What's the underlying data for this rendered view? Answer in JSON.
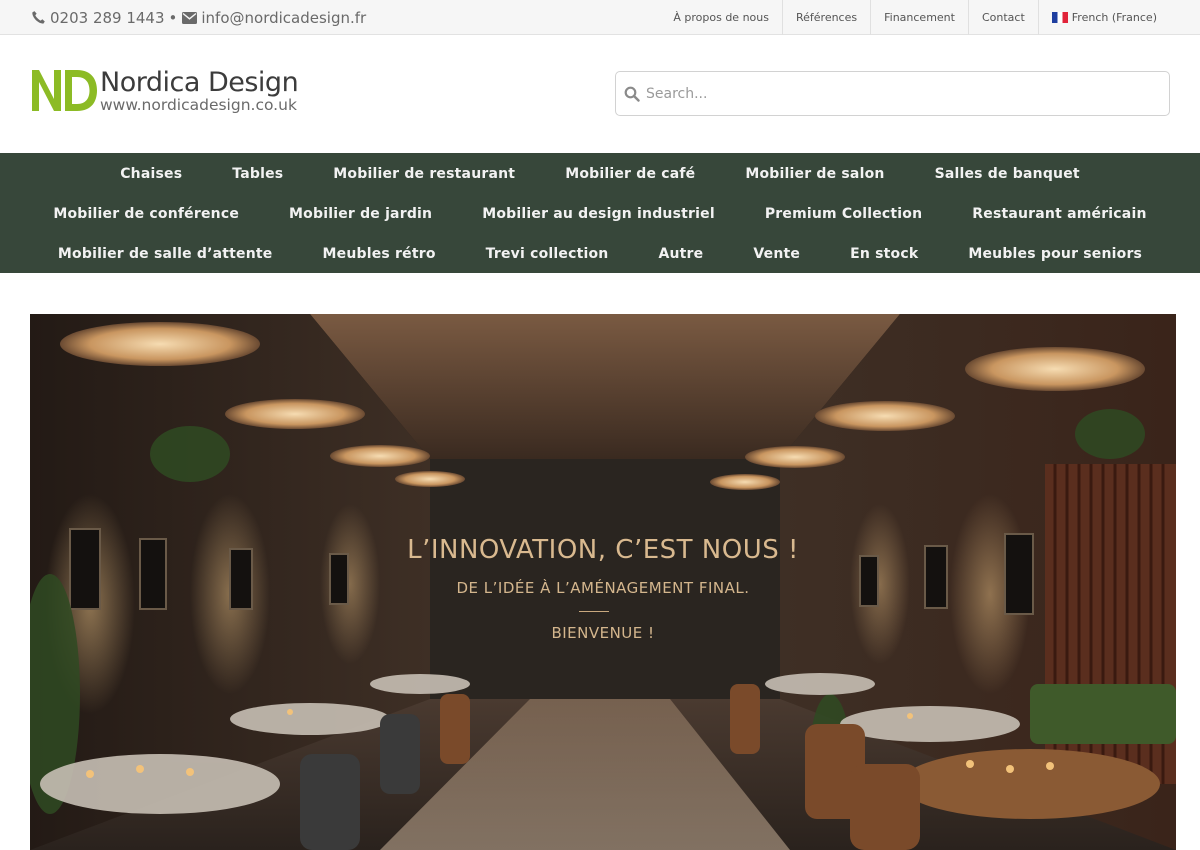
{
  "topbar": {
    "phone": "0203 289 1443",
    "separator": "•",
    "email": "info@nordicadesign.fr",
    "links": [
      "À propos de nous",
      "Références",
      "Financement",
      "Contact"
    ],
    "language": "French (France)"
  },
  "logo": {
    "mark": "ND",
    "name": "Nordica Design",
    "url": "www.nordicadesign.co.uk",
    "colors": {
      "green": "#8cbb25",
      "dark": "#3c3c3c"
    }
  },
  "search": {
    "placeholder": "Search..."
  },
  "nav": {
    "background": "#37473a",
    "row1": [
      "Chaises",
      "Tables",
      "Mobilier de restaurant",
      "Mobilier de café",
      "Mobilier de salon",
      "Salles de banquet"
    ],
    "row2": [
      "Mobilier de conférence",
      "Mobilier de jardin",
      "Mobilier au design industriel",
      "Premium Collection",
      "Restaurant américain"
    ],
    "row3": [
      "Mobilier de salle d’attente",
      "Meubles rétro",
      "Trevi collection",
      "Autre",
      "Vente",
      "En stock",
      "Meubles pour seniors"
    ]
  },
  "hero": {
    "title": "L’INNOVATION, C’EST NOUS !",
    "subtitle": "DE L’IDÉE À L’AMÉNAGEMENT FINAL.",
    "welcome": "BIENVENUE !"
  },
  "icons": {
    "phone": "phone-icon",
    "email": "envelope-icon",
    "search": "search-icon",
    "flag": "french-flag-icon"
  }
}
